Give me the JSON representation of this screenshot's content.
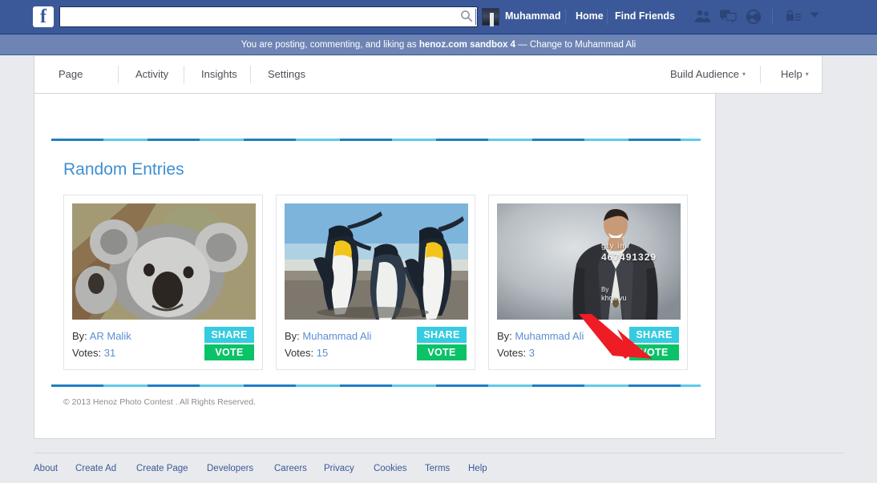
{
  "fb_bar": {
    "logo": "f",
    "search_placeholder": "",
    "search_value": "",
    "search_icon": "search-icon",
    "profile_name": "Muhammad",
    "home_label": "Home",
    "find_friends_label": "Find Friends",
    "icons": [
      "friend-requests-icon",
      "messages-icon",
      "notifications-globe-icon",
      "privacy-lock-icon",
      "account-caret-icon"
    ],
    "bg_color": "#3b5998"
  },
  "sandbox_banner": {
    "prefix": "You are posting, commenting, and liking as ",
    "identity": "henoz.com sandbox 4",
    "separator": " — ",
    "change_link": "Change to Muhammad Ali",
    "bg_color": "#6d84b4"
  },
  "tabbar": {
    "tabs": [
      "Page",
      "Activity",
      "Insights",
      "Settings"
    ],
    "right_items": [
      {
        "label": "Build Audience",
        "caret": "▾"
      },
      {
        "label": "Help",
        "caret": "▾"
      }
    ]
  },
  "app": {
    "section_title": "Random Entries",
    "copyright": "© 2013 Henoz Photo Contest . All Rights Reserved.",
    "rule_colors": [
      "#1f7ec4",
      "#5fcbe8"
    ],
    "title_color": "#3f8fd2",
    "by_label": "By:",
    "votes_label": "Votes:",
    "share_label": "SHARE",
    "vote_label": "VOTE",
    "share_color": "#35cbe0",
    "vote_color": "#0bc268",
    "entries": [
      {
        "photo": "koala-photo",
        "author": "AR Malik",
        "votes": "31"
      },
      {
        "photo": "penguins-photo",
        "author": "Muhammad Ali",
        "votes": "15"
      },
      {
        "photo": "man-in-suit-photo",
        "author": "Muhammad Ali",
        "votes": "3",
        "watermark_line1": "gty im/",
        "watermark_line2": "467491329",
        "watermark_by": "By",
        "watermark_author": "khoa vu"
      }
    ]
  },
  "annotation": {
    "arrow_color": "#ee1c25",
    "target": "vote-button-card-3"
  },
  "footer": {
    "links": [
      "About",
      "Create Ad",
      "Create Page",
      "Developers",
      "Careers",
      "Privacy",
      "Cookies",
      "Terms",
      "Help"
    ]
  }
}
